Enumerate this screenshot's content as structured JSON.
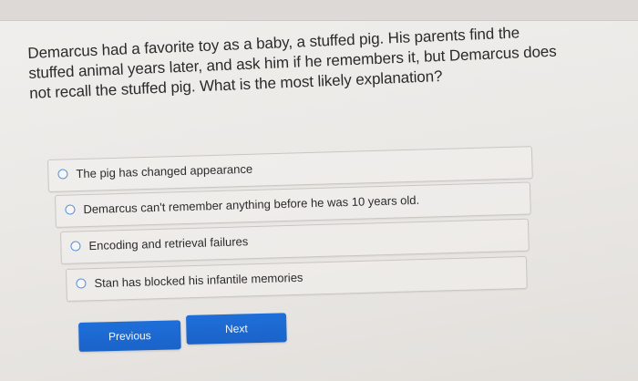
{
  "question": {
    "text": "Demarcus had a favorite toy as a baby, a stuffed pig. His parents find the stuffed animal years later, and ask him if he remembers it, but Demarcus does not recall the stuffed pig. What is the most likely explanation?"
  },
  "options": [
    {
      "label": "The pig has changed appearance"
    },
    {
      "label": "Demarcus can't remember anything before he was 10 years old."
    },
    {
      "label": "Encoding and retrieval failures"
    },
    {
      "label": "Stan has blocked his infantile memories"
    }
  ],
  "navigation": {
    "previous_label": "Previous",
    "next_label": "Next"
  },
  "colors": {
    "accent": "#1f6fd9",
    "radio_border": "#5a8fd6"
  },
  "icons": {
    "radio": "radio-unselected-icon"
  }
}
